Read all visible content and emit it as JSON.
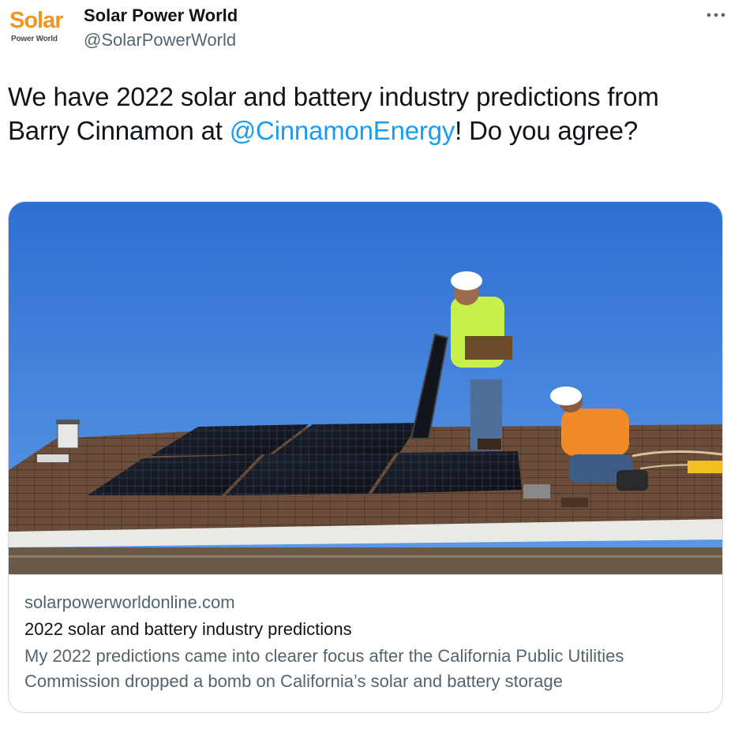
{
  "author": {
    "logo_main": "Solar",
    "logo_sub": "Power World",
    "display_name": "Solar Power World",
    "handle": "@SolarPowerWorld"
  },
  "menu": {
    "icon": "more-horizontal-icon"
  },
  "tweet": {
    "text_before": "We have 2022 solar and battery industry predictions from Barry Cinnamon at ",
    "mention": "@CinnamonEnergy",
    "text_after": "! Do you agree?"
  },
  "card": {
    "domain": "solarpowerworldonline.com",
    "title": "2022 solar and battery industry predictions",
    "description": "My 2022 predictions came into clearer focus after the California Public Utilities Commission dropped a bomb on California’s solar and battery storage"
  },
  "colors": {
    "link": "#1d9bf0",
    "secondary_text": "#536471",
    "primary_text": "#0f1419",
    "logo_orange": "#f0961e",
    "border": "#cfd9de"
  }
}
